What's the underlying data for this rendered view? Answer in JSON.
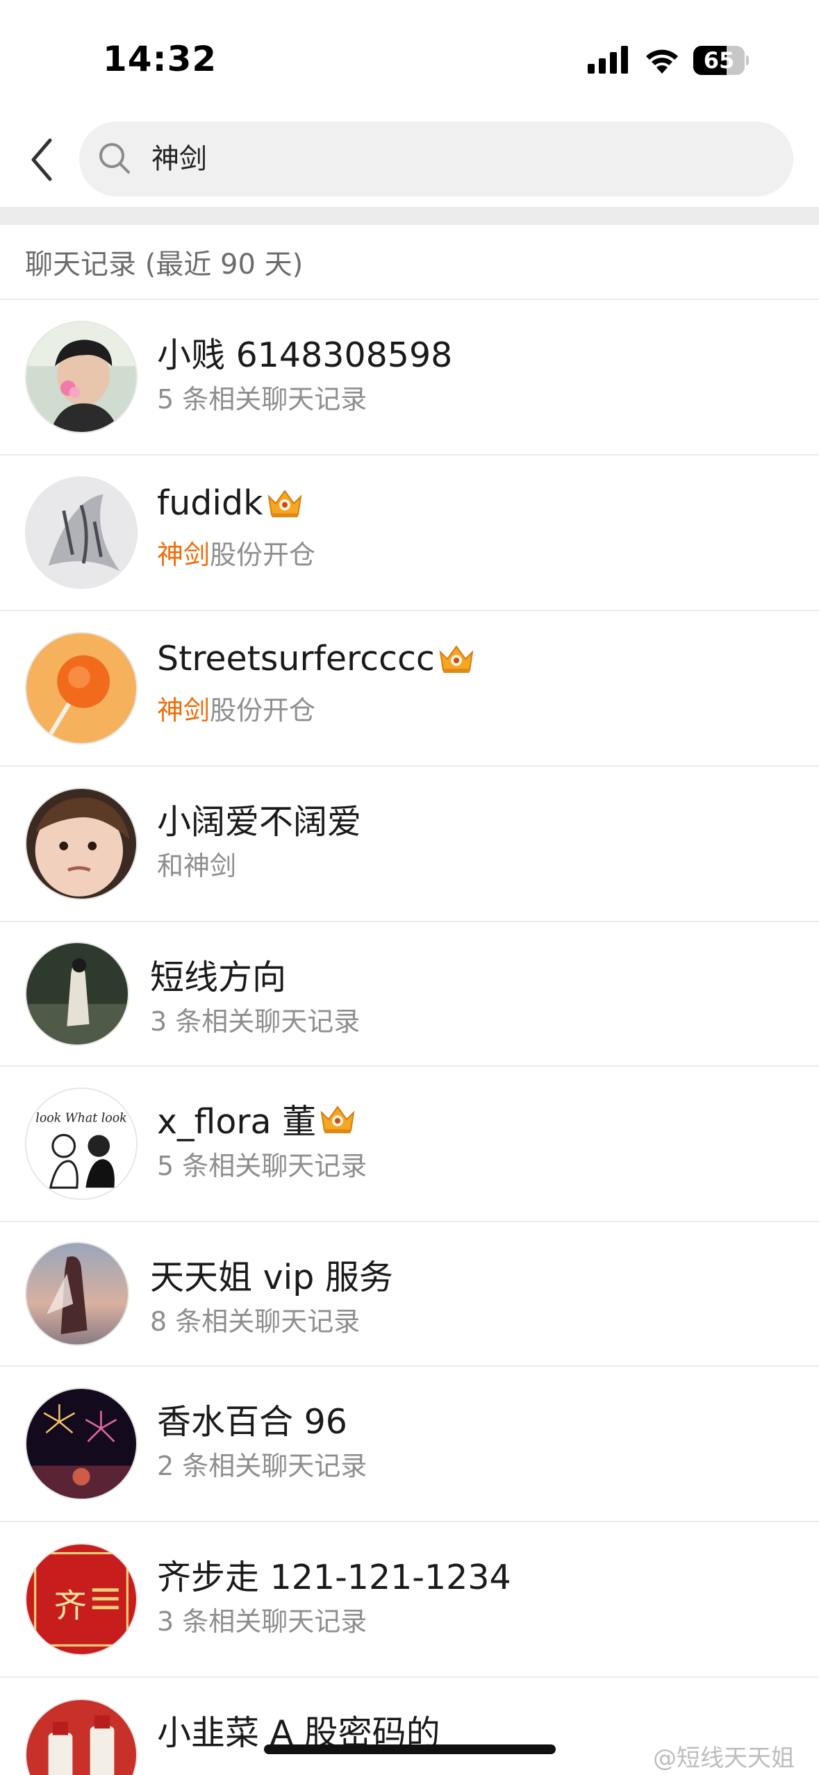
{
  "status_bar": {
    "time": "14:32",
    "battery": "65",
    "battery_level": 0.65
  },
  "search": {
    "query": "神剑",
    "placeholder": ""
  },
  "section_title": "聊天记录 (最近 90 天)",
  "results": [
    {
      "name": "小贱 6148308598",
      "crown": false,
      "sub_pre": "",
      "sub_highlight": "",
      "sub_post": "5 条相关聊天记录",
      "avatar": "photo-boy"
    },
    {
      "name": "fudidk",
      "crown": true,
      "sub_pre": "",
      "sub_highlight": "神剑",
      "sub_post": "股份开仓",
      "avatar": "calligraphy"
    },
    {
      "name": "Streetsurfercccc",
      "crown": true,
      "sub_pre": "",
      "sub_highlight": "神剑",
      "sub_post": "股份开仓",
      "avatar": "lollipop"
    },
    {
      "name": "小阔爱不阔爱",
      "crown": false,
      "sub_pre": "和神剑",
      "sub_highlight": "",
      "sub_post": "",
      "avatar": "baby-face"
    },
    {
      "name": "短线方向",
      "crown": false,
      "sub_pre": "",
      "sub_highlight": "",
      "sub_post": "3 条相关聊天记录",
      "avatar": "dark-figure"
    },
    {
      "name": "x_flora 董",
      "crown": true,
      "sub_pre": "",
      "sub_highlight": "",
      "sub_post": "5 条相关聊天记录",
      "avatar": "look-what-look",
      "avatar_text": "look What look"
    },
    {
      "name": "天天姐 vip 服务",
      "crown": false,
      "sub_pre": "",
      "sub_highlight": "",
      "sub_post": "8 条相关聊天记录",
      "avatar": "sunset-figure"
    },
    {
      "name": "香水百合 96",
      "crown": false,
      "sub_pre": "",
      "sub_highlight": "",
      "sub_post": "2 条相关聊天记录",
      "avatar": "fireworks"
    },
    {
      "name": "齐步走 121-121-1234",
      "crown": false,
      "sub_pre": "",
      "sub_highlight": "",
      "sub_post": "3 条相关聊天记录",
      "avatar": "red-poster",
      "avatar_text": "齐"
    },
    {
      "name": "小韭菜 A 股密码的",
      "crown": false,
      "sub_pre": "",
      "sub_highlight": "",
      "sub_post": "",
      "avatar": "bottles"
    }
  ],
  "watermark": "@短线天天姐"
}
